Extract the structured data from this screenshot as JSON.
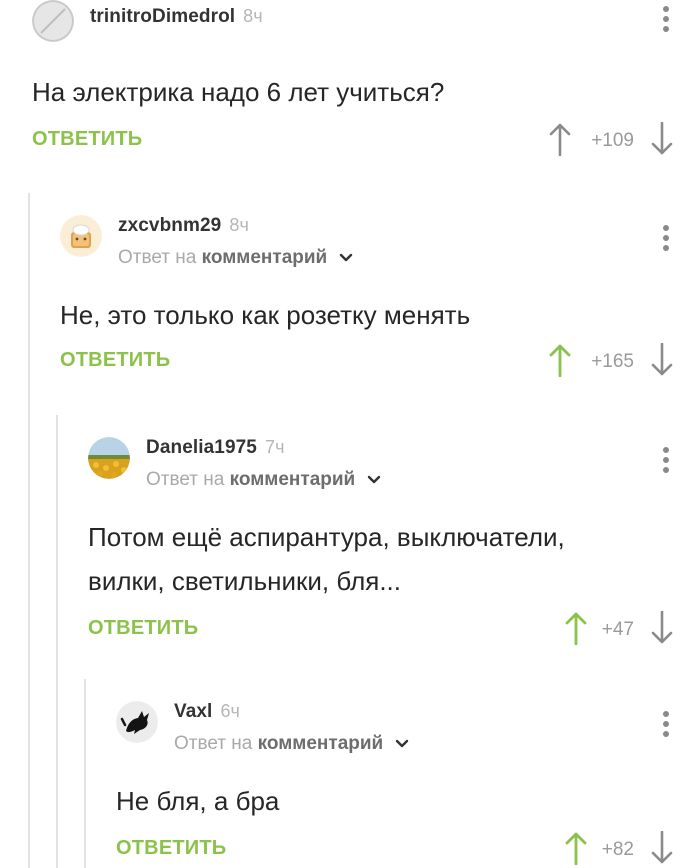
{
  "colors": {
    "reply": "#8bc34a",
    "upvote_active": "#8bc34a",
    "upvote_neutral": "#8a8a8a",
    "downvote": "#8a8a8a",
    "thread_line": "#e3e3e3"
  },
  "comments": [
    {
      "username": "trinitroDimedrol",
      "time": "8ч",
      "text": "На электрика надо 6 лет учиться?",
      "reply_label": "ОТВЕТИТЬ",
      "rating": "+109",
      "avatar_icon": "pill-icon",
      "upvoted": false
    },
    {
      "username": "zxcvbnm29",
      "time": "8ч",
      "reply_prefix": "Ответ на",
      "reply_link": "комментарий",
      "text": "Не, это только как розетку менять",
      "reply_label": "ОТВЕТИТЬ",
      "rating": "+165",
      "avatar_icon": "toast-icon",
      "upvoted": true
    },
    {
      "username": "Danelia1975",
      "time": "7ч",
      "reply_prefix": "Ответ на",
      "reply_link": "комментарий",
      "text_line1": "Потом ещё аспирантура, выключатели,",
      "text_line2": "вилки, светильники, бля...",
      "reply_label": "ОТВЕТИТЬ",
      "rating": "+47",
      "avatar_icon": "sunflower-field-icon",
      "upvoted": true
    },
    {
      "username": "Vaxl",
      "time": "6ч",
      "reply_prefix": "Ответ на",
      "reply_link": "комментарий",
      "text": "Не бля, а бра",
      "reply_label": "ОТВЕТИТЬ",
      "rating": "+82",
      "avatar_icon": "black-cat-icon",
      "upvoted": true
    }
  ]
}
